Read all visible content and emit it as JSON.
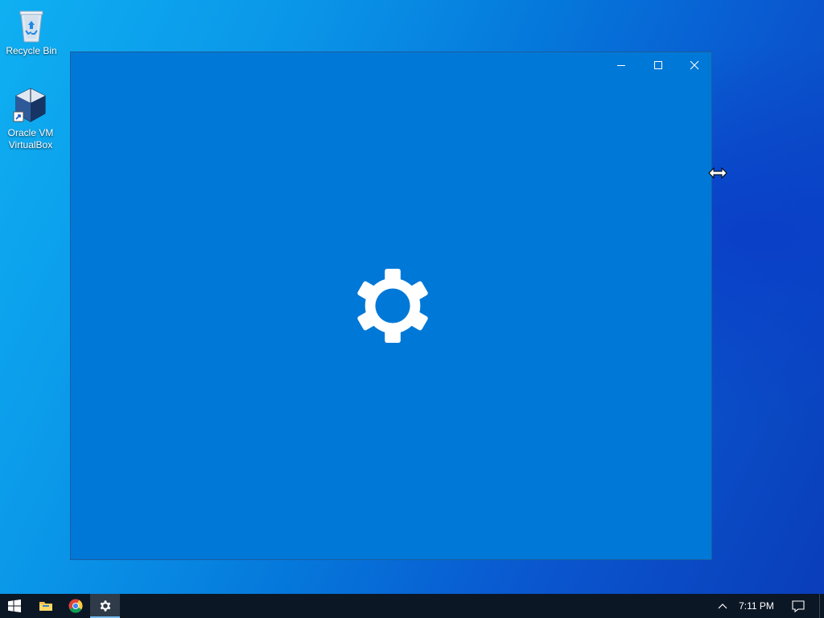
{
  "desktop": {
    "background_colors": [
      "#0fb0f2",
      "#0578db",
      "#0a3cb8"
    ],
    "icons": [
      {
        "label_lines": [
          "Recycle Bin"
        ],
        "icon": "recycle-bin-icon"
      },
      {
        "label_lines": [
          "Oracle VM",
          "VirtualBox"
        ],
        "icon": "virtualbox-icon"
      }
    ]
  },
  "window": {
    "background_color": "#0078d7",
    "splash_icon": "gear-icon",
    "controls": [
      "minimize-icon",
      "maximize-icon",
      "close-icon"
    ]
  },
  "cursor": "horizontal-resize-cursor",
  "taskbar": {
    "background_color": "#0c1726",
    "items": [
      {
        "name": "start",
        "icon": "windows-logo-icon"
      },
      {
        "name": "file-explorer",
        "icon": "folder-icon"
      },
      {
        "name": "chrome",
        "icon": "chrome-icon"
      },
      {
        "name": "settings",
        "icon": "gear-icon",
        "active": true
      }
    ],
    "tray": {
      "overflow_icon": "chevron-up-icon",
      "time": "7:11 PM",
      "action_center_icon": "notification-icon"
    }
  }
}
